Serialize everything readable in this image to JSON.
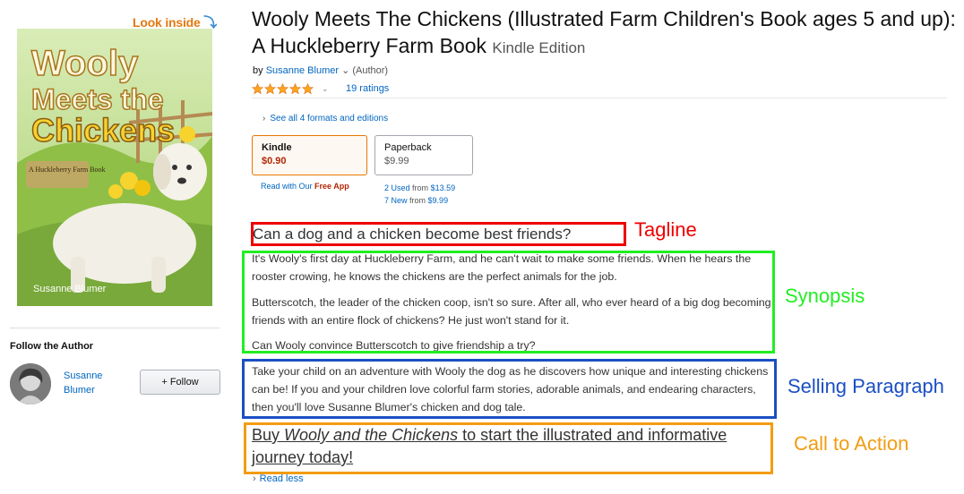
{
  "look_inside": "Look inside",
  "cover": {
    "title_line1": "Wooly",
    "title_line2": "Meets the",
    "title_line3": "Chickens",
    "series": "A Huckleberry Farm Book",
    "author": "Susanne Blumer"
  },
  "product": {
    "title": "Wooly Meets The Chickens (Illustrated Farm Children's Book ages 5 and up): A Huckleberry Farm Book",
    "edition": "Kindle Edition",
    "by": "by",
    "author": "Susanne Blumer",
    "author_role": "(Author)",
    "rating_stars": 5,
    "ratings_count": "19 ratings",
    "see_all_formats": "See all 4 formats and editions"
  },
  "formats": {
    "kindle": {
      "name": "Kindle",
      "price": "$0.90"
    },
    "paperback": {
      "name": "Paperback",
      "price": "$9.99"
    },
    "read_with": "Read with Our",
    "free_app": "Free App",
    "used_label": "2 Used",
    "used_from": "from",
    "used_price": "$13.59",
    "new_label": "7 New",
    "new_from": "from",
    "new_price": "$9.99"
  },
  "description": {
    "tagline": "Can a dog and a chicken become best friends?",
    "synopsis_1": "It's Wooly's first day at Huckleberry Farm, and he can't wait to make some friends. When he hears the rooster crowing, he knows the chickens are the perfect animals for the job.",
    "synopsis_2": "Butterscotch, the leader of the chicken coop, isn't so sure. After all, who ever heard of a big dog becoming friends with an entire flock of chickens? He just won't stand for it.",
    "synopsis_3": "Can Wooly convince Butterscotch to give friendship a try?",
    "selling": "Take your child on an adventure with Wooly the dog as he discovers how unique and interesting chickens can be! If you and your children love colorful farm stories, adorable animals, and endearing characters, then you'll love Susanne Blumer's chicken and dog tale.",
    "cta_prefix": "Buy ",
    "cta_title": "Wooly and the Chickens",
    "cta_suffix": " to start the illustrated and informative journey today!",
    "read_less": "Read less"
  },
  "annotations": {
    "tagline": "Tagline",
    "synopsis": "Synopsis",
    "selling": "Selling Paragraph",
    "cta": "Call to Action"
  },
  "follow": {
    "heading": "Follow the Author",
    "author_name": "Susanne Blumer",
    "button": "+ Follow"
  },
  "colors": {
    "tagline_box": "#ee0000",
    "synopsis_box": "#22ee22",
    "selling_box": "#1a4fc4",
    "cta_box": "#f39c12",
    "link": "#0066c0",
    "price": "#b12704",
    "star": "#ffa41c"
  }
}
